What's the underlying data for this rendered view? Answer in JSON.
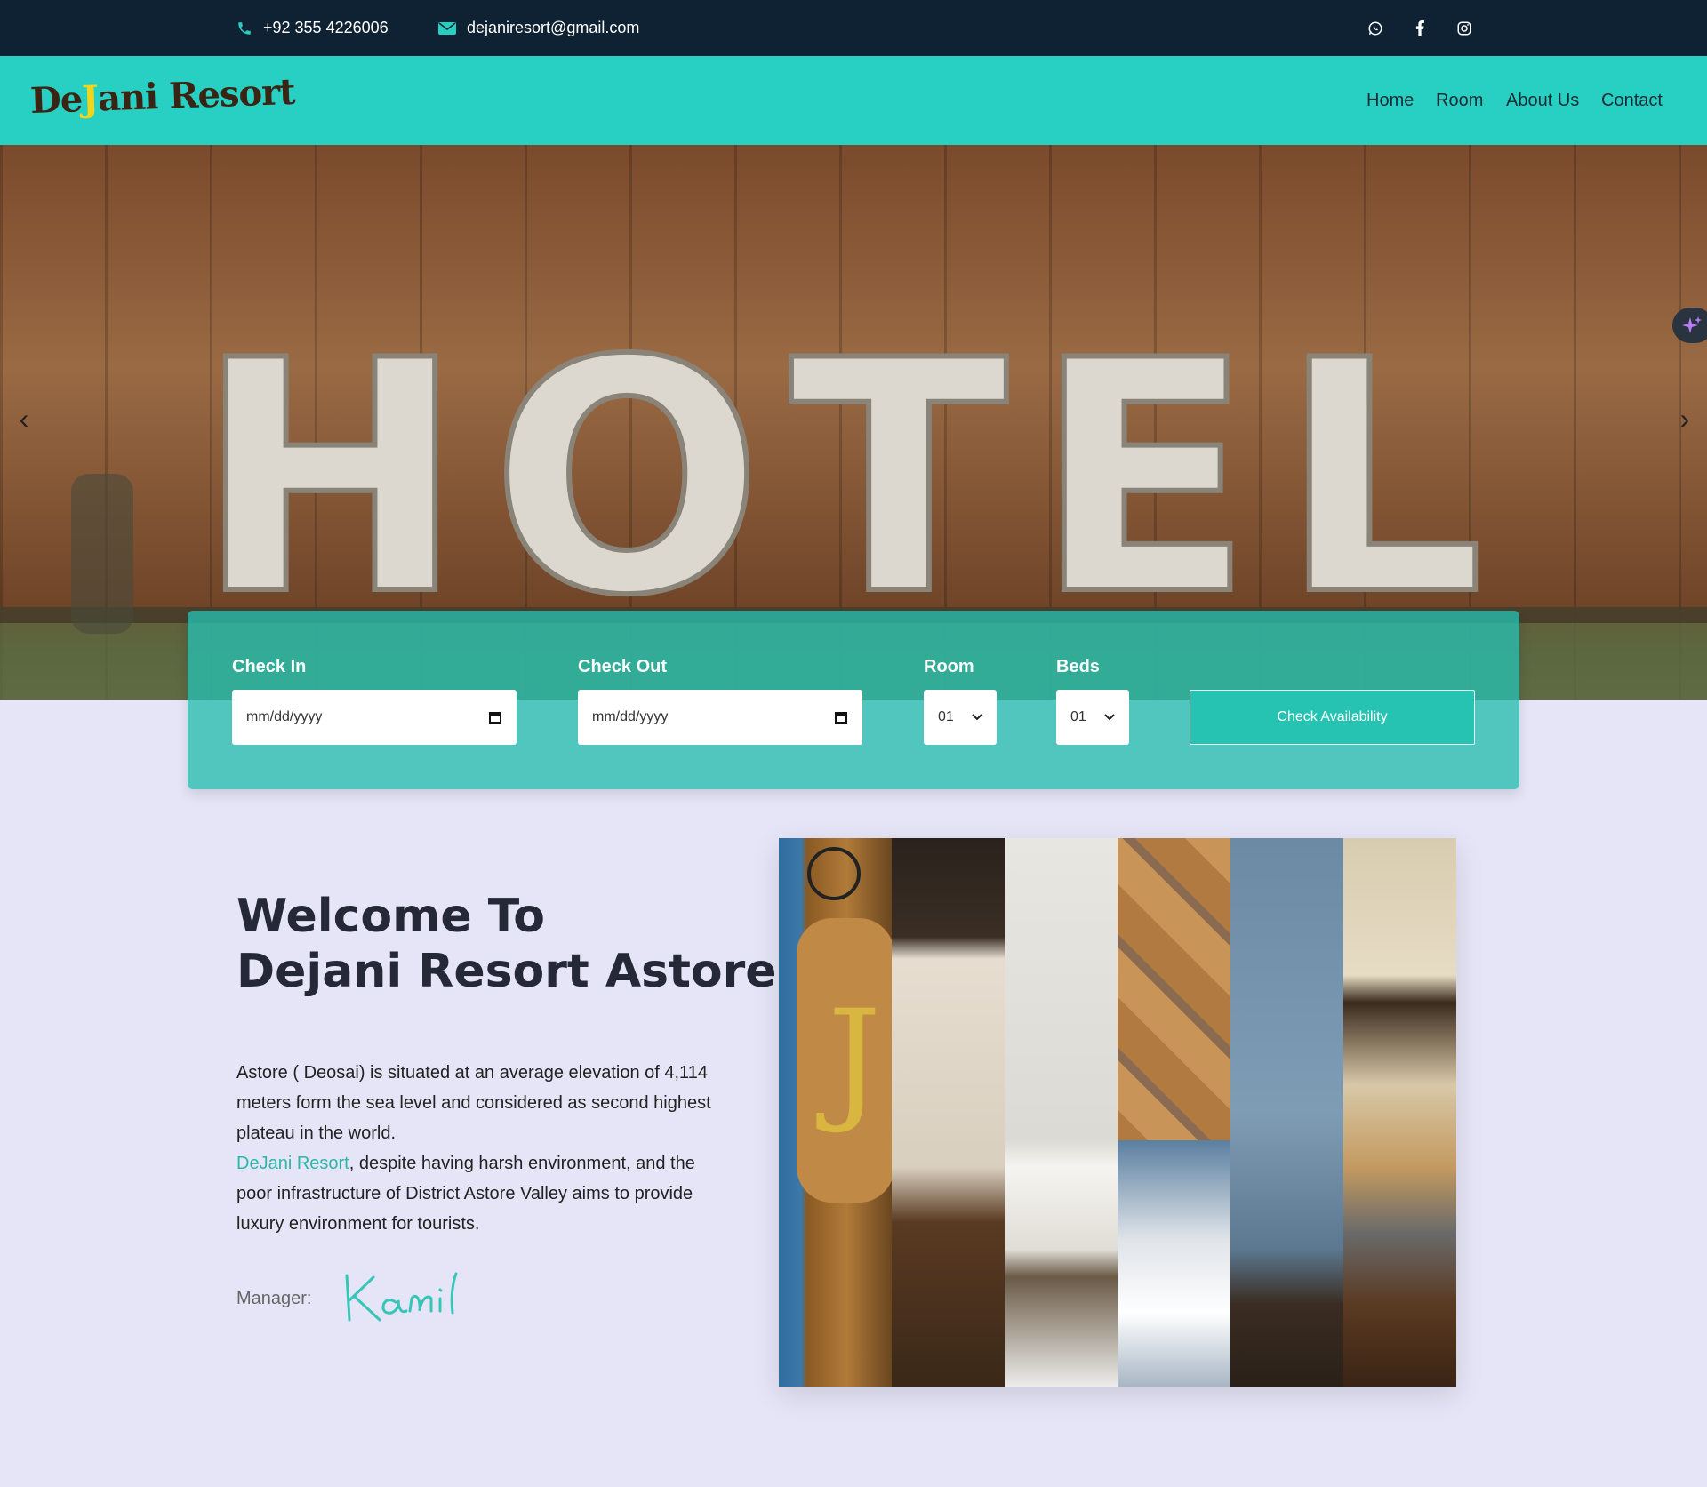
{
  "topbar": {
    "phone": "+92 355 4226006",
    "email": "dejaniresort@gmail.com",
    "social": [
      "whatsapp-icon",
      "facebook-icon",
      "instagram-icon"
    ]
  },
  "nav": {
    "logo": {
      "pre": "De",
      "accent": "J",
      "post": "ani Resort"
    },
    "links": [
      "Home",
      "Room",
      "About Us",
      "Contact"
    ]
  },
  "hero": {
    "sign_text": "HOTEL",
    "prev": "‹",
    "next": "›"
  },
  "booking": {
    "checkin_label": "Check In",
    "checkin_placeholder": "mm/dd/yyyy",
    "checkout_label": "Check Out",
    "checkout_placeholder": "mm/dd/yyyy",
    "room_label": "Room",
    "room_value": "01",
    "beds_label": "Beds",
    "beds_value": "01",
    "button": "Check Availability"
  },
  "welcome": {
    "title_line1": "Welcome To",
    "title_line2": "Dejani Resort Astore",
    "para1": "Astore ( Deosai) is situated at an average elevation of 4,114 meters form the sea level and considered as second highest plateau in the world.",
    "para2_highlight": "DeJani Resort",
    "para2_rest": ", despite having harsh environment, and the poor infrastructure of District Astore Valley aims to provide luxury environment for tourists.",
    "manager_label": "Manager:",
    "manager_signature": "Kamil"
  },
  "colors": {
    "topbar": "#0f2234",
    "nav": "#27d0c2",
    "accent": "#2bb7a9",
    "page_bg": "#e6e5f7"
  }
}
